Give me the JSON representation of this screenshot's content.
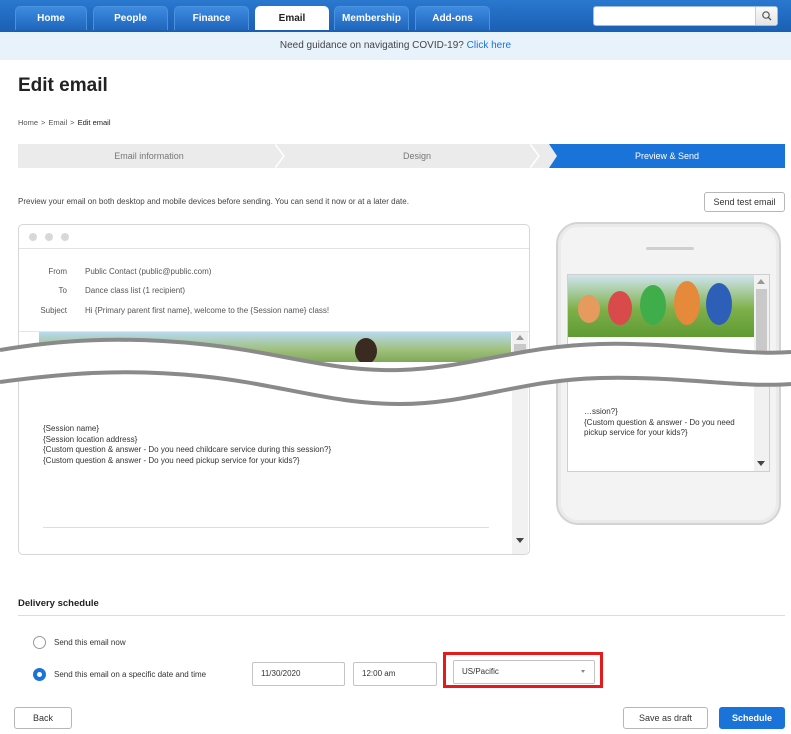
{
  "nav": {
    "tabs": [
      "Home",
      "People",
      "Finance",
      "Email",
      "Membership",
      "Add-ons"
    ],
    "active_tab": "Email",
    "search_icon": "search-icon"
  },
  "banner": {
    "text": "Need guidance on navigating COVID-19?",
    "link": "Click here"
  },
  "page": {
    "title": "Edit email",
    "breadcrumb": [
      "Home",
      "Email",
      "Edit email"
    ]
  },
  "steps": [
    "Email information",
    "Design",
    "Preview & Send"
  ],
  "intro": "Preview your email on both desktop and mobile devices before sending. You can send it now or at a later date.",
  "send_test_label": "Send test email",
  "desktop_preview": {
    "from_label": "From",
    "from_value": "Public Contact (public@public.com)",
    "to_label": "To",
    "to_value": "Dance class list (1 recipient)",
    "subject_label": "Subject",
    "subject_value": "Hi {Primary parent first name}, welcome to the {Session name} class!",
    "body_lines": [
      "{Session name}",
      "{Session location address}",
      "{Custom question & answer - Do you need childcare service during this session?}",
      "{Custom question & answer - Do you need pickup service for your kids?}"
    ]
  },
  "mobile_preview": {
    "body_lines": [
      "…ssion?}",
      "{Custom question & answer - Do you need pickup service for your kids?}"
    ]
  },
  "delivery": {
    "title": "Delivery schedule",
    "option_now": "Send this email now",
    "option_later": "Send this email on a specific date and time",
    "selected": "later",
    "date": "11/30/2020",
    "time": "12:00 am",
    "timezone": "US/Pacific"
  },
  "footer": {
    "back": "Back",
    "save_draft": "Save as draft",
    "schedule": "Schedule"
  },
  "colors": {
    "accent": "#1a73d9",
    "highlight": "#e51b1b"
  }
}
